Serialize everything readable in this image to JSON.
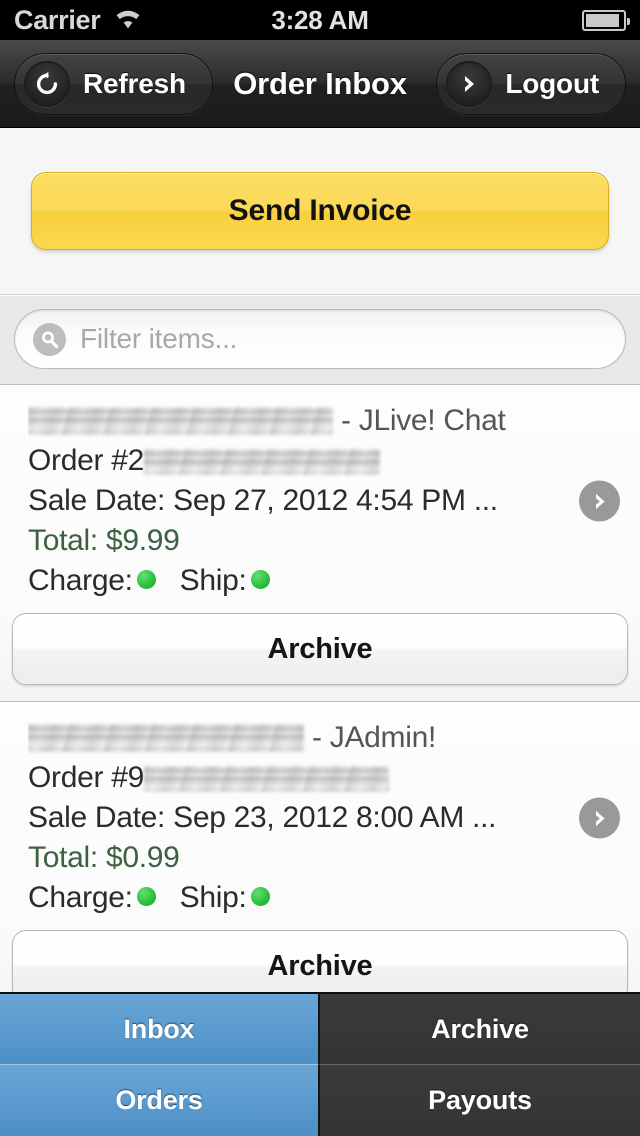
{
  "status_bar": {
    "carrier": "Carrier",
    "time": "3:28 AM",
    "wifi_icon": "wifi-icon",
    "battery_icon": "battery-icon",
    "battery_level": 93
  },
  "nav_bar": {
    "title": "Order Inbox",
    "left_button": {
      "label": "Refresh",
      "icon": "refresh-icon"
    },
    "right_button": {
      "label": "Logout",
      "icon": "chevron-right-icon"
    }
  },
  "actions": {
    "send_invoice_label": "Send Invoice",
    "accent_color": "#fbd95a"
  },
  "search": {
    "placeholder": "Filter items...",
    "value": "",
    "icon": "search-icon"
  },
  "orders": [
    {
      "buyer_name_redacted": true,
      "product_suffix": " - JLive! Chat",
      "order_label": "Order #",
      "order_number_prefix": "2",
      "order_number_redacted": true,
      "sale_date_label": "Sale Date: ",
      "sale_date": "Sep 27, 2012 4:54 PM ...",
      "total_label": "Total: ",
      "total": "$9.99",
      "charge_label": "Charge:",
      "charge_status": "green",
      "ship_label": "Ship:",
      "ship_status": "green",
      "archive_label": "Archive",
      "disclosure_icon": "chevron-right-icon"
    },
    {
      "buyer_name_redacted": true,
      "product_suffix": " - JAdmin!",
      "order_label": "Order #",
      "order_number_prefix": "9",
      "order_number_redacted": true,
      "sale_date_label": "Sale Date: ",
      "sale_date": "Sep 23, 2012 8:00 AM ...",
      "total_label": "Total: ",
      "total": "$0.99",
      "charge_label": "Charge:",
      "charge_status": "green",
      "ship_label": "Ship:",
      "ship_status": "green",
      "archive_label": "Archive",
      "disclosure_icon": "chevron-right-icon"
    }
  ],
  "tab_bar": {
    "selected_color": "#5b9bcf",
    "tabs": [
      {
        "label": "Inbox",
        "active": true
      },
      {
        "label": "Archive",
        "active": false
      },
      {
        "label": "Orders",
        "active": true
      },
      {
        "label": "Payouts",
        "active": false
      }
    ]
  },
  "status_colors": {
    "green": "#2ec63d",
    "total_text": "#3c6040"
  }
}
